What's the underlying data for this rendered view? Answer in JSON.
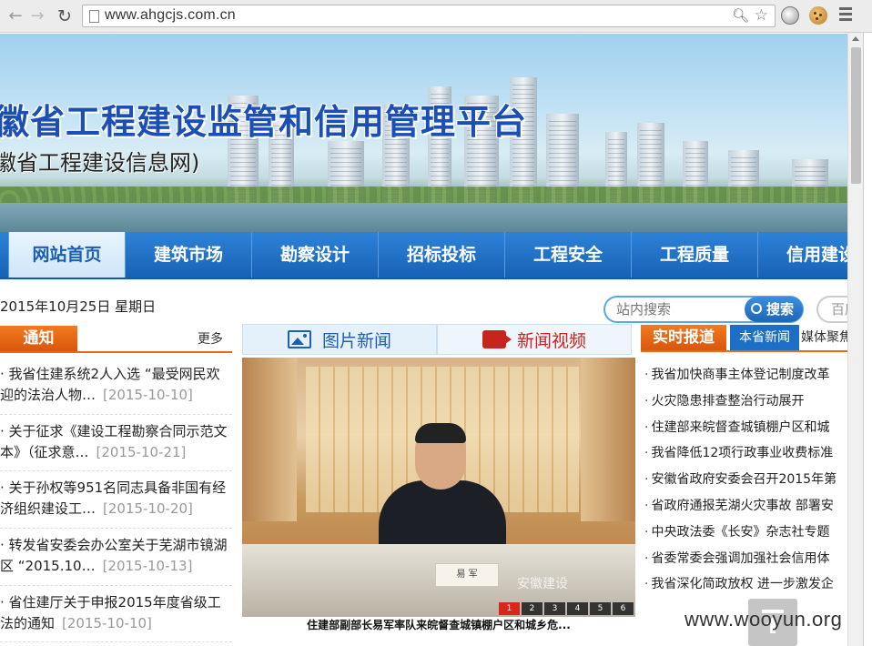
{
  "browser": {
    "url": "www.ahgcjs.com.cn"
  },
  "banner": {
    "title": "徽省工程建设监管和信用管理平台",
    "subtitle": "徽省工程建设信息网)"
  },
  "nav": {
    "items": [
      "网站首页",
      "建筑市场",
      "勘察设计",
      "招标投标",
      "工程安全",
      "工程质量",
      "信用建设"
    ]
  },
  "date": "2015年10月25日 星期日",
  "search": {
    "placeholder": "站内搜索",
    "button": "搜索",
    "baidu": "百度"
  },
  "notice": {
    "title": "通知",
    "more": "更多",
    "items": [
      {
        "text": "· 我省住建系统2人入选 “最受网民欢迎的法治人物…",
        "date": "[2015-10-10]"
      },
      {
        "text": "· 关于征求《建设工程勘察合同示范文本》（征求意…",
        "date": "[2015-10-21]"
      },
      {
        "text": "· 关于孙权等951名同志具备非国有经济组织建设工…",
        "date": "[2015-10-20]"
      },
      {
        "text": "· 转发省安委会办公室关于芜湖市镜湖区 “2015.10…",
        "date": "[2015-10-13]"
      },
      {
        "text": "· 省住建厅关于申报2015年度省级工法的通知",
        "date": "[2015-10-10]"
      }
    ]
  },
  "center": {
    "tab_photo": "图片新闻",
    "tab_video": "新闻视频",
    "nameplate": "易 军",
    "watermark": "安徽建设",
    "pages": [
      "1",
      "2",
      "3",
      "4",
      "5",
      "6"
    ],
    "caption": "住建部副部长易军率队来皖督查城镇棚户区和城乡危..."
  },
  "realtime": {
    "title": "实时报道",
    "tab1": "本省新闻",
    "tab2": "媒体聚焦",
    "items": [
      "我省加快商事主体登记制度改革",
      "火灾隐患排查整治行动展开",
      "住建部来皖督查城镇棚户区和城",
      "我省降低12项行政事业收费标准",
      "安徽省政府安委会召开2015年第",
      "省政府通报芜湖火灾事故 部署安",
      "中央政法委《长安》杂志社专题",
      "省委常委会强调加强社会信用体",
      "我省深化简政放权 进一步激发企"
    ]
  },
  "overlay": {
    "site_watermark": "www.wooyun.org"
  }
}
